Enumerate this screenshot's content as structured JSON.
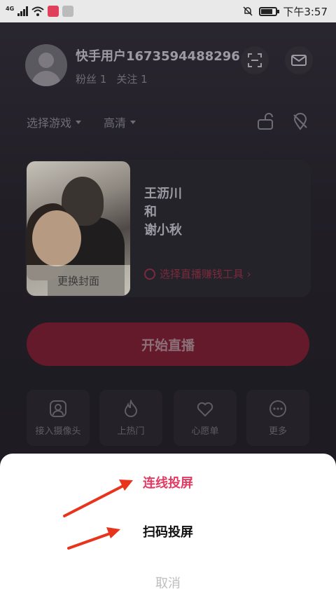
{
  "status_bar": {
    "network": "4G",
    "time": "下午3:57",
    "battery_level": 0.72
  },
  "profile": {
    "username": "快手用户1673594488296",
    "fans_label": "粉丝 1",
    "follow_label": "关注 1"
  },
  "options": {
    "game_select": "选择游戏",
    "quality": "高清"
  },
  "live_card": {
    "cover_label": "更换封面",
    "title_lines": [
      "王沥川",
      "和",
      "谢小秋"
    ],
    "earn_tool_link": "选择直播赚钱工具 ›"
  },
  "start_button": "开始直播",
  "tiles": [
    {
      "label": "接入摄像头",
      "icon": "camera-person-icon"
    },
    {
      "label": "上热门",
      "icon": "flame-icon"
    },
    {
      "label": "心愿单",
      "icon": "heart-icon"
    },
    {
      "label": "更多",
      "icon": "more-dots-icon"
    }
  ],
  "sheet": {
    "cast_option": "连线投屏",
    "scan_option": "扫码投屏",
    "cancel": "取消"
  },
  "colors": {
    "accent_pink": "#e33a64",
    "arrow_red": "#e8341c",
    "start_button_bg": "#651a2c"
  }
}
